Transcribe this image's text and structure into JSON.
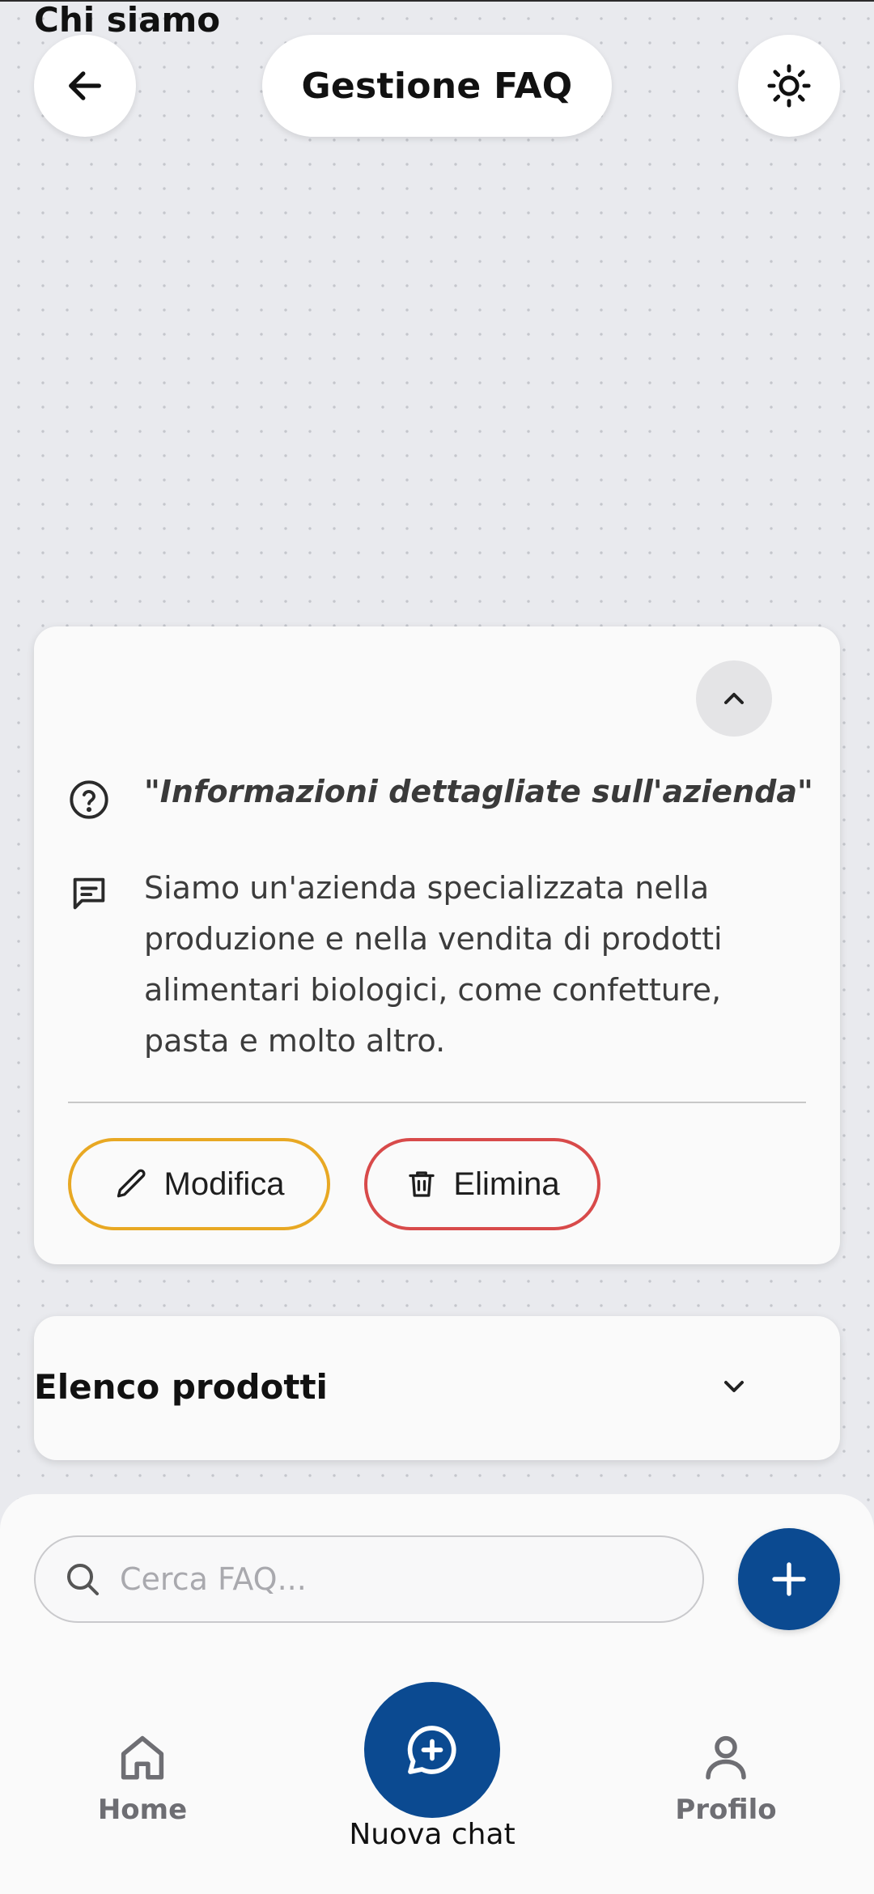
{
  "header": {
    "title": "Gestione FAQ"
  },
  "faqs": [
    {
      "title": "Chi siamo",
      "expanded": true,
      "question": "\"Informazioni dettagliate sull'azienda\"",
      "answer": "Siamo un'azienda specializzata nella produzione e nella vendita di prodotti alimentari biologici, come confetture, pasta e molto altro.",
      "edit_label": "Modifica",
      "delete_label": "Elimina"
    },
    {
      "title": "Elenco prodotti",
      "expanded": false
    }
  ],
  "search": {
    "placeholder": "Cerca FAQ...",
    "value": ""
  },
  "bottom_nav": {
    "home_label": "Home",
    "new_chat_label": "Nuova chat",
    "profile_label": "Profilo"
  },
  "colors": {
    "primary": "#0b4a91",
    "edit_border": "#e8a823",
    "delete_border": "#d84a4a",
    "background": "#e9eaee",
    "card": "#fafafa"
  },
  "icons": {
    "back": "arrow-left-icon",
    "theme": "sun-icon",
    "collapse": "chevron-up-icon",
    "expand": "chevron-down-icon",
    "question": "help-circle-icon",
    "answer": "message-square-icon",
    "edit": "pencil-icon",
    "delete": "trash-icon",
    "search": "search-icon",
    "add": "plus-icon",
    "home": "home-icon",
    "new_chat": "chat-plus-icon",
    "profile": "user-icon"
  }
}
